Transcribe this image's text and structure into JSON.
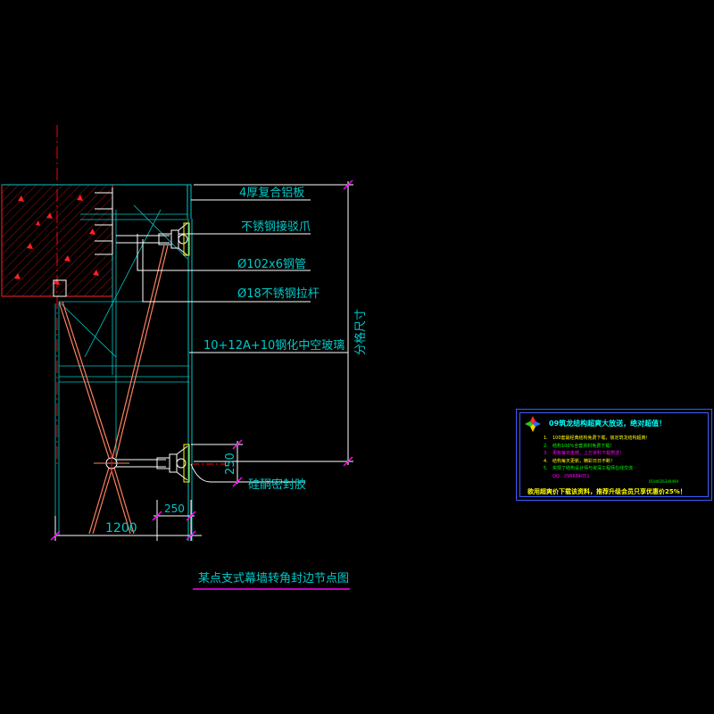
{
  "drawing": {
    "title": "某点支式幕墙转角封边节点图",
    "labels": {
      "aluminum_panel": "4厚复合铝板",
      "steel_claw": "不锈钢接驳爪",
      "steel_pipe": "Ø102x6钢管",
      "tie_rod": "Ø18不锈钢拉杆",
      "glass": "10+12A+10钢化中空玻璃",
      "sealant": "硅酮密封胶",
      "grid_size": "分格尺寸"
    },
    "dimensions": {
      "width": "1200",
      "offset_h": "250",
      "offset_v": "250"
    },
    "colors": {
      "background": "#000000",
      "line_cyan": "#00c8c8",
      "leader_white": "#ffffff",
      "dim_magenta": "#ff00ff",
      "concrete_red": "#ff2020",
      "rod_salmon": "#ff8060",
      "axis_red": "#ff0000"
    }
  },
  "ad_panel": {
    "headline": "09筑龙结构超爽大放送，绝对超值！",
    "items": [
      {
        "num": "1.",
        "text": "100套最经典结构免费下载，锁定筑龙结构超爽！",
        "color": "#ffff00"
      },
      {
        "num": "2.",
        "text": "结构100%全套资料免费下载！",
        "color": "#00ff00"
      },
      {
        "num": "3.",
        "text": "更有每日金牌，上万资料下载赠送！",
        "color": "#ff00ff"
      },
      {
        "num": "4.",
        "text": "结构每天更新，精彩日日不断！",
        "color": "#ffff00"
      },
      {
        "num": "5.",
        "text": "实现了结构设计师与资深工程师在线交流",
        "color": "#00ff00"
      }
    ],
    "qq": "QQ：296684051",
    "code": "0194026349494",
    "footer": "欲用超爽价下载该资料，推荐升级会员只享优惠价25%！"
  }
}
